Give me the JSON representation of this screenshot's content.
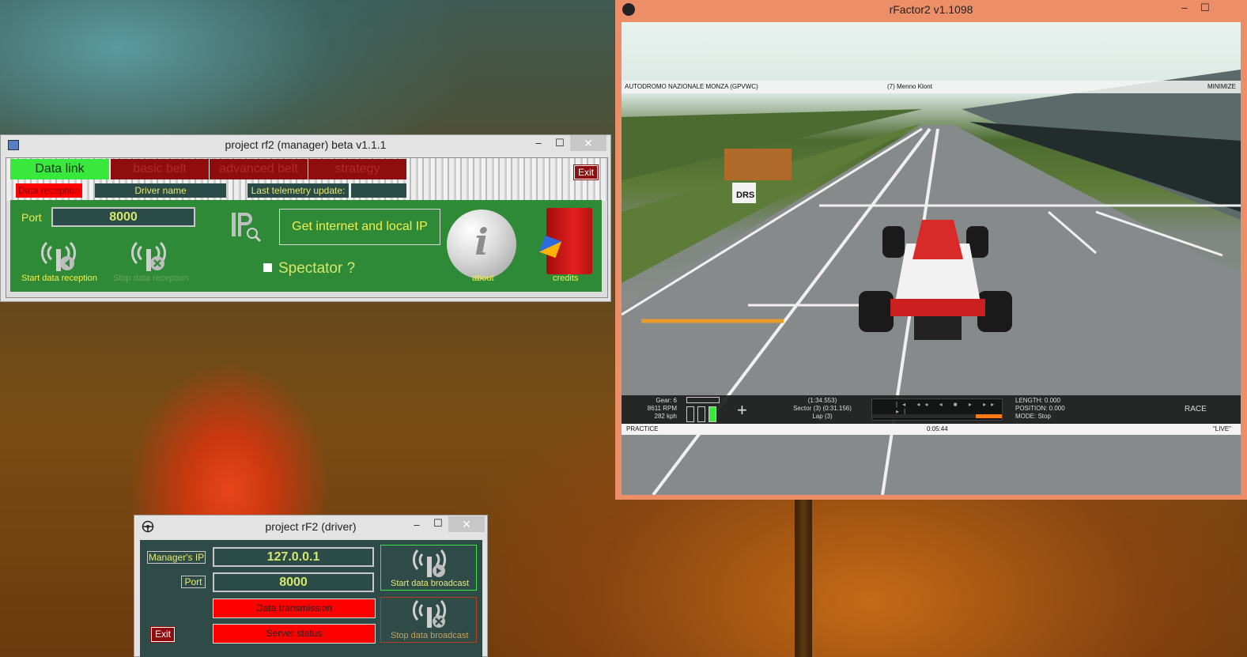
{
  "desktop": {
    "background": "orange tulip wallpaper"
  },
  "manager_window": {
    "title": "project rf2 (manager) beta v1.1.1",
    "controls": {
      "minimize": "–",
      "maximize": "☐",
      "close": "✕"
    },
    "tabs": [
      {
        "label": "Data link",
        "active": true
      },
      {
        "label": "basic belt",
        "active": false
      },
      {
        "label": "advanced belt",
        "active": false
      },
      {
        "label": "strategy",
        "active": false
      }
    ],
    "exit_label": "Exit",
    "labels": {
      "data_reception": "Data reception",
      "driver_name": "Driver name",
      "last_update": "Last telemetry update:"
    },
    "port_label": "Port",
    "port_value": "8000",
    "ip_button": "Get internet and local IP",
    "spectator_label": "Spectator ?",
    "start_reception": "Start data reception",
    "stop_reception": "Stop data reception",
    "about": "about",
    "credits": "credits",
    "colors": {
      "accent_green": "#39e83c",
      "dark_red": "#8e0d0d",
      "panel_green": "#2f8a37"
    }
  },
  "driver_window": {
    "title": "project rF2 (driver)",
    "controls": {
      "minimize": "–",
      "maximize": "☐",
      "close": "✕"
    },
    "managers_ip_label": "Manager's IP",
    "managers_ip_value": "127.0.0.1",
    "port_label": "Port",
    "port_value": "8000",
    "data_transmission": "Data transmission",
    "server_status": "Server status",
    "start_broadcast": "Start data broadcast",
    "stop_broadcast": "Stop data broadcast",
    "exit_label": "Exit"
  },
  "rfactor_window": {
    "title": "rFactor2 v1.1098",
    "controls": {
      "minimize": "–",
      "maximize": "☐"
    },
    "hud": {
      "track": "AUTODROMO NAZIONALE MONZA (GPVWC)",
      "driver": "(7) Menno Klont",
      "top_right": "MINIMIZE",
      "gear": "Gear: 6",
      "rpm": "8611 RPM",
      "speed": "282 kph",
      "lap_time": "(1:34.553)",
      "sector": "Sector (3) (0:31.156)",
      "lap": "Lap (3)",
      "length": "LENGTH: 0.000",
      "position": "POSITION: 0.000",
      "mode": "MODE: Stop",
      "race": "RACE",
      "session": "PRACTICE",
      "clock": "0:05:44",
      "live": "\"LIVE\"",
      "drs_sign": "DRS"
    }
  }
}
